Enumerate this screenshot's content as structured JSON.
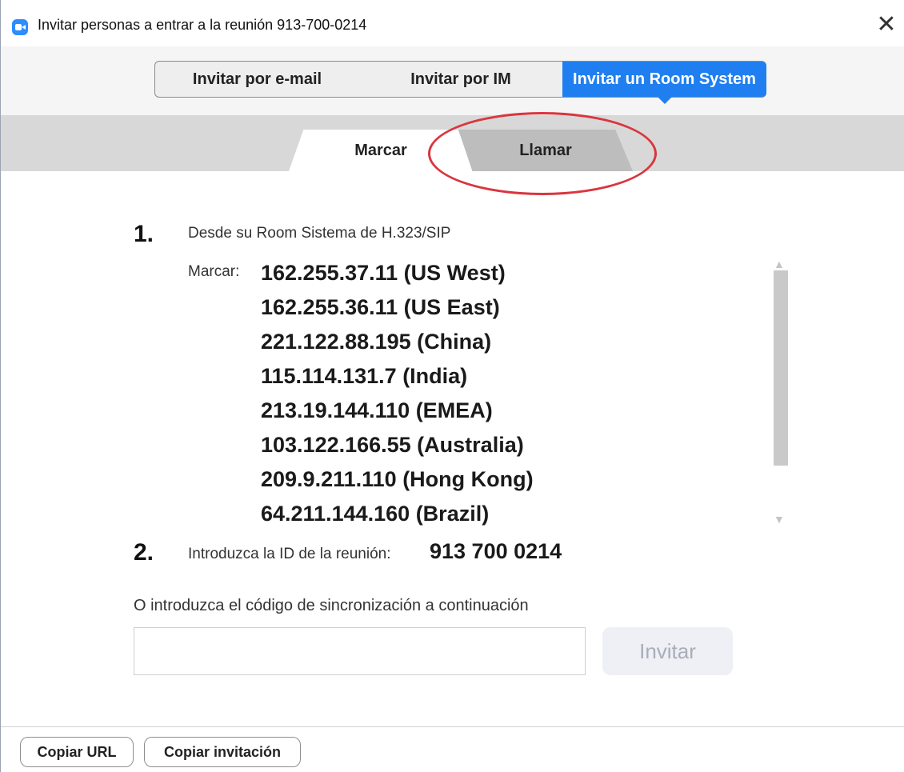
{
  "window": {
    "title": "Invitar personas a entrar a la reunión 913-700-0214",
    "app_icon": "zoom-camera-icon",
    "close_glyph": "✕"
  },
  "top_tabs": [
    {
      "label": "Invitar por e-mail",
      "selected": false
    },
    {
      "label": "Invitar por IM",
      "selected": false
    },
    {
      "label": "Invitar un Room System",
      "selected": true
    }
  ],
  "sub_tabs": [
    {
      "label": "Marcar",
      "selected": true
    },
    {
      "label": "Llamar",
      "selected": false,
      "highlighted": true
    }
  ],
  "step1": {
    "number": "1.",
    "text": "Desde su Room Sistema de H.323/SIP",
    "dial_label": "Marcar:",
    "addresses": [
      "162.255.37.11 (US West)",
      "162.255.36.11 (US East)",
      "221.122.88.195 (China)",
      "115.114.131.7 (India)",
      "213.19.144.110 (EMEA)",
      "103.122.166.55 (Australia)",
      "209.9.211.110 (Hong Kong)",
      "64.211.144.160 (Brazil)"
    ]
  },
  "step2": {
    "number": "2.",
    "text": "Introduzca la ID de la reunión:",
    "meeting_id": "913 700 0214"
  },
  "sync": {
    "label": "O introduzca el código de sincronización a continuación",
    "input_value": "",
    "placeholder": "",
    "button_label": "Invitar",
    "button_enabled": false
  },
  "footer": {
    "copy_url_label": "Copiar URL",
    "copy_invitation_label": "Copiar invitación"
  },
  "colors": {
    "accent": "#1f7ff0",
    "highlight_ring": "#d9363e"
  }
}
